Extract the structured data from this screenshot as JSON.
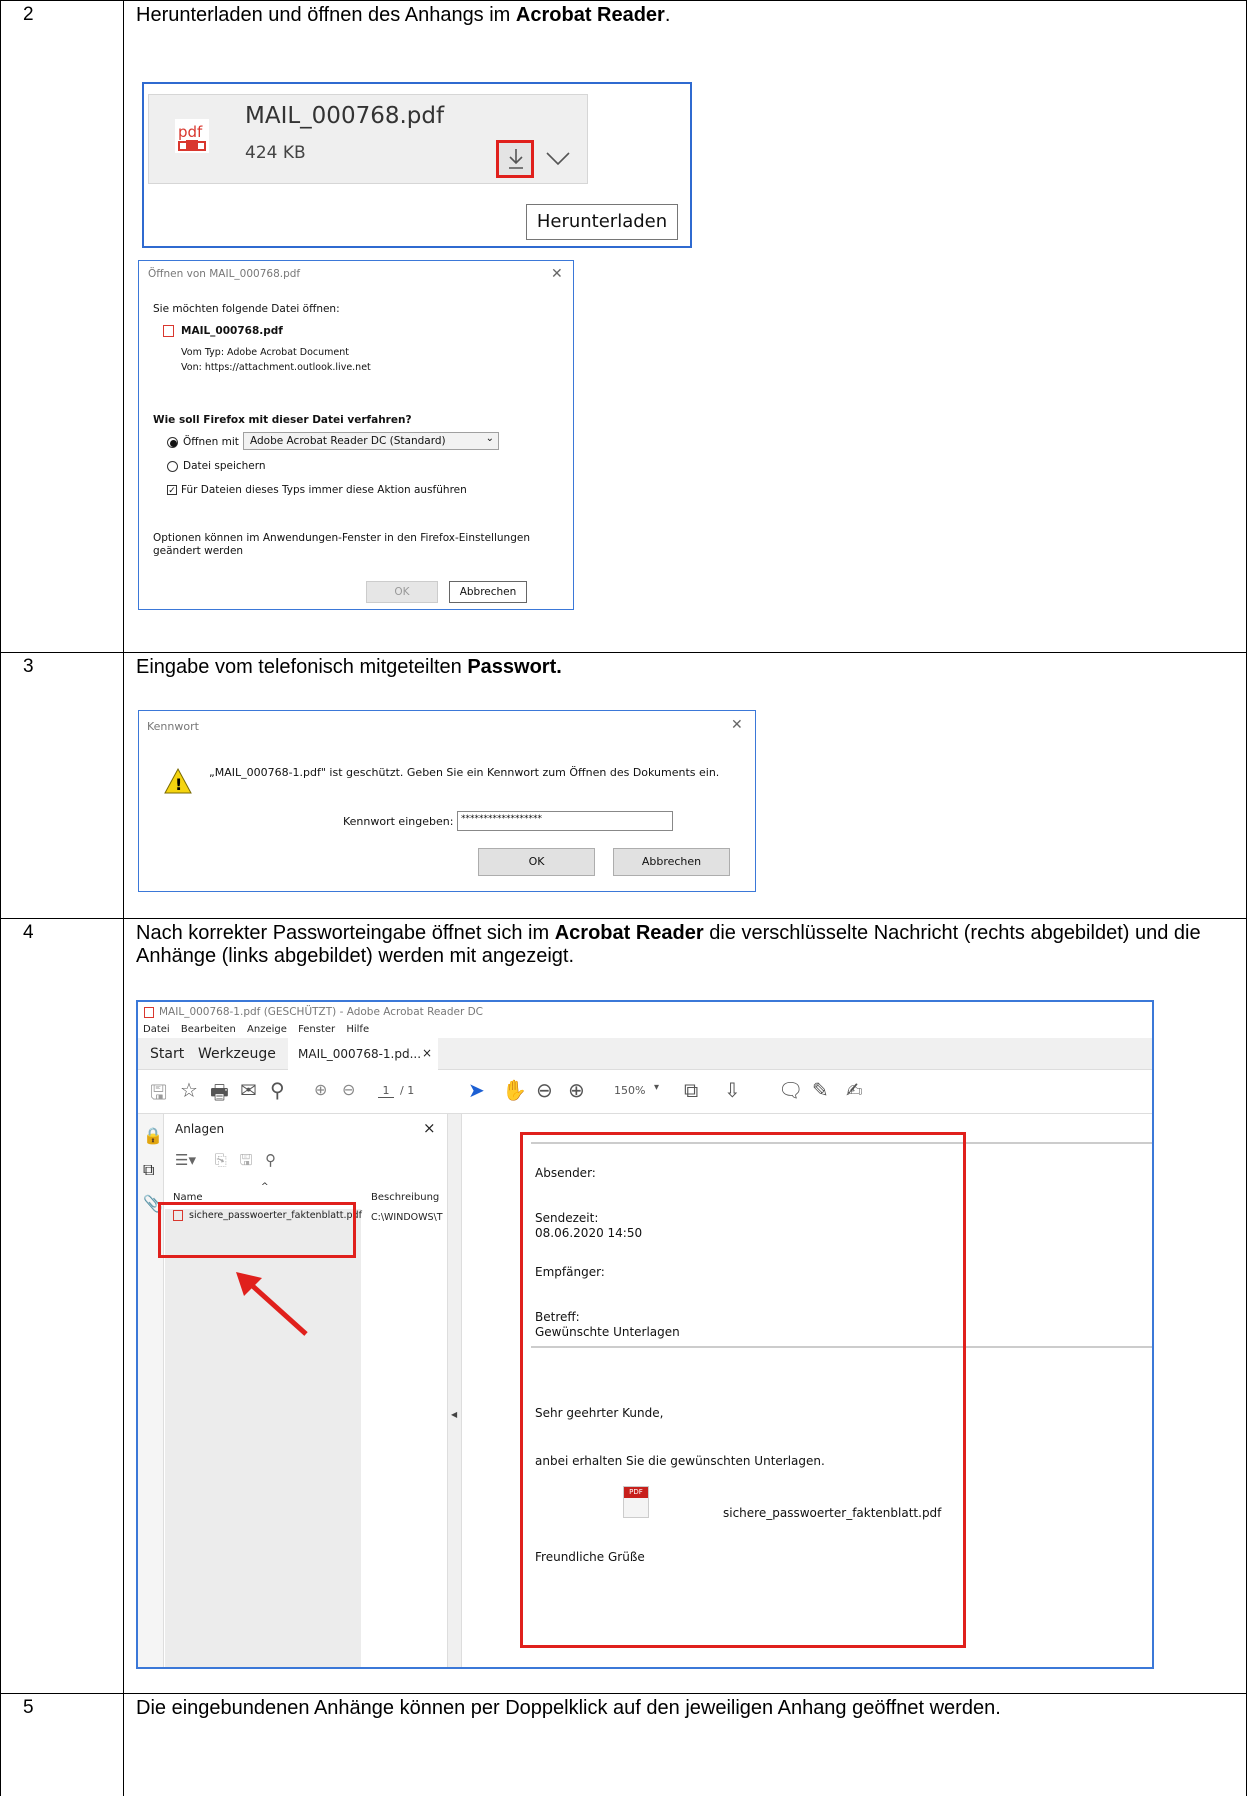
{
  "steps": [
    {
      "num": "2",
      "text_before": "Herunterladen und öffnen des Anhangs im ",
      "text_bold": "Acrobat Reader",
      "text_after": "."
    },
    {
      "num": "3",
      "text_before": "Eingabe vom telefonisch mitgeteilten ",
      "text_bold": "Passwort.",
      "text_after": ""
    },
    {
      "num": "4",
      "text_before": "Nach korrekter Passworteingabe öffnet sich im ",
      "text_bold": "Acrobat Reader",
      "text_after": " die verschlüsselte Nachricht (rechts abgebildet) und die Anhänge (links abgebildet) werden mit angezeigt."
    },
    {
      "num": "5",
      "text_before": "Die eingebundenen Anhänge können per Doppelklick auf den jeweiligen Anhang geöffnet werden.",
      "text_bold": "",
      "text_after": ""
    }
  ],
  "attachment": {
    "icon_label": "pdf",
    "filename": "MAIL_000768.pdf",
    "size": "424 KB",
    "download_tooltip": "Herunterladen"
  },
  "firefox_dialog": {
    "title": "Öffnen von MAIL_000768.pdf",
    "intro": "Sie möchten folgende Datei öffnen:",
    "filename": "MAIL_000768.pdf",
    "type_line": "Vom Typ: Adobe Acrobat Document",
    "from_line": "Von: https://attachment.outlook.live.net",
    "question": "Wie soll Firefox mit dieser Datei verfahren?",
    "open_with_label": "Öffnen mit",
    "open_with_value": "Adobe Acrobat Reader DC  (Standard)",
    "save_label": "Datei speichern",
    "always_label": "Für Dateien dieses Typs immer diese Aktion ausführen",
    "options_note": "Optionen können im Anwendungen-Fenster in den Firefox-Einstellungen geändert werden",
    "ok": "OK",
    "cancel": "Abbrechen"
  },
  "password_dialog": {
    "title": "Kennwort",
    "message": "„MAIL_000768-1.pdf\" ist geschützt. Geben Sie ein Kennwort zum Öffnen des Dokuments ein.",
    "field_label": "Kennwort eingeben:",
    "field_value": "******************",
    "ok": "OK",
    "cancel": "Abbrechen"
  },
  "acrobat": {
    "title": "MAIL_000768-1.pdf (GESCHÜTZT) - Adobe Acrobat Reader DC",
    "menu": [
      "Datei",
      "Bearbeiten",
      "Anzeige",
      "Fenster",
      "Hilfe"
    ],
    "tabs": [
      "Start",
      "Werkzeuge",
      "MAIL_000768-1.pd..."
    ],
    "tab_close": "×",
    "page_current": "1",
    "page_total": "/ 1",
    "zoom": "150%",
    "panel_title": "Anlagen",
    "panel_close": "×",
    "col_name": "Name",
    "col_desc": "Beschreibung",
    "attachment_name": "sichere_passwoerter_faktenblatt.pdf",
    "attachment_desc": "C:\\WINDOWS\\T",
    "doc": {
      "sender_label": "Absender:",
      "sent_label": "Sendezeit:",
      "sent_value": "08.06.2020 14:50",
      "recipient_label": "Empfänger:",
      "subject_label": "Betreff:",
      "subject_value": "Gewünschte Unterlagen",
      "greeting": "Sehr geehrter Kunde,",
      "body": "anbei erhalten Sie die gewünschten Unterlagen.",
      "pdf_icon_label": "PDF",
      "attachment_name": "sichere_passwoerter_faktenblatt.pdf",
      "closing": "Freundliche Grüße"
    }
  }
}
